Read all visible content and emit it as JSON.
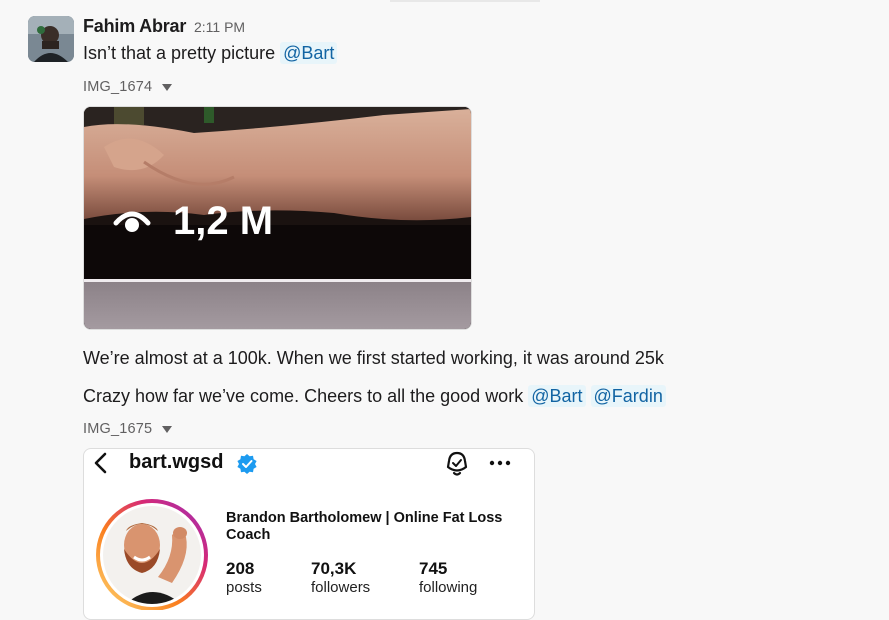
{
  "message": {
    "author": "Fahim Abrar",
    "time": "2:11 PM",
    "text1": "Isn’t that a pretty picture",
    "mention1": "@Bart",
    "file1_name": "IMG_1674",
    "image1_views": "1,2 M",
    "text2": "We’re almost at a 100k. When we first started working, it was around 25k",
    "text3": "Crazy how far we’ve come. Cheers to all the good work",
    "mention2": "@Bart",
    "mention3": "@Fardin",
    "file2_name": "IMG_1675"
  },
  "profile": {
    "handle": "bart.wgsd",
    "name": "Brandon Bartholomew | Online Fat Loss Coach",
    "posts_value": "208",
    "posts_label": "posts",
    "followers_value": "70,3K",
    "followers_label": "followers",
    "following_value": "745",
    "following_label": "following"
  },
  "colors": {
    "mention_bg": "#e8f5fa",
    "mention_text": "#1264a3",
    "verified": "#1d9bf0"
  },
  "icons": [
    "caret-down-icon",
    "eye-icon",
    "back-chevron-icon",
    "verified-badge-icon",
    "notification-bell-icon",
    "more-options-icon"
  ]
}
